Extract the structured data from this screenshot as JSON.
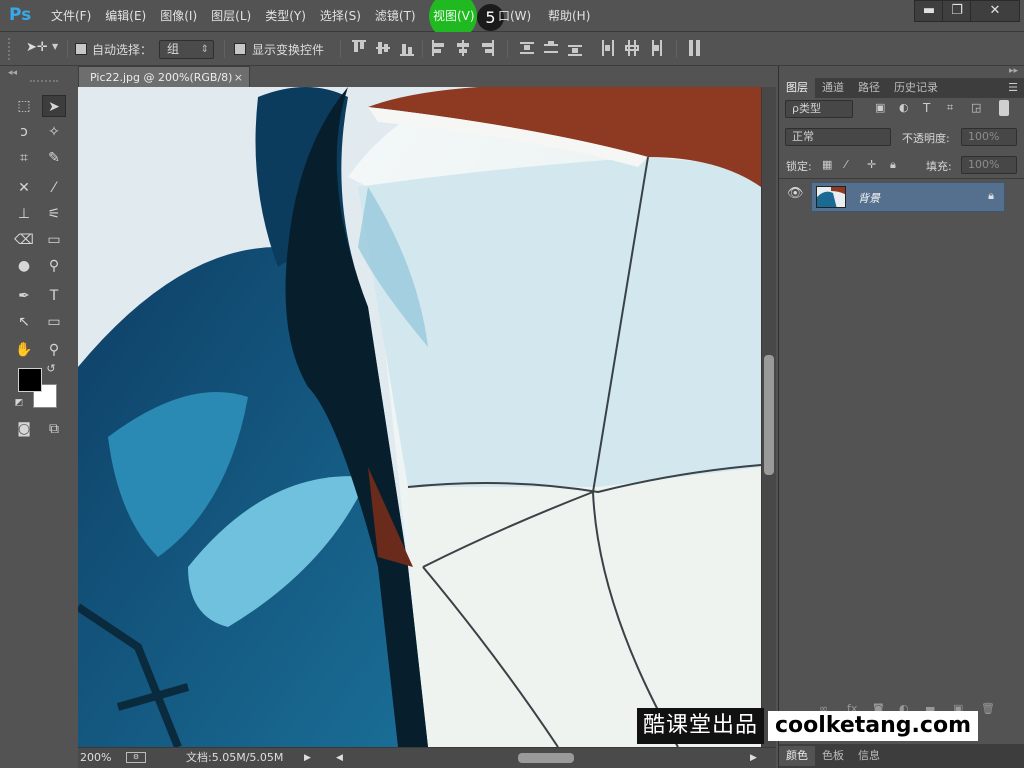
{
  "app": {
    "logo": "Ps"
  },
  "menu": {
    "items": [
      "文件(F)",
      "编辑(E)",
      "图像(I)",
      "图层(L)",
      "类型(Y)",
      "选择(S)",
      "滤镜(T)"
    ],
    "view_label": "视图(V)",
    "window_label": "口(W)",
    "help_label": "帮助(H)",
    "step_badge": "5"
  },
  "window_controls": {
    "minimize": "▬",
    "restore": "❐",
    "close": "✕"
  },
  "options_bar": {
    "auto_select_label": "自动选择：",
    "auto_select_value": "组",
    "show_transform_label": "显示变换控件"
  },
  "document": {
    "tab_title": "Pic22.jpg @ 200%(RGB/8)",
    "close_glyph": "×"
  },
  "status": {
    "zoom": "200%",
    "doc_info": "文档:5.05M/5.05M"
  },
  "panels": {
    "tabs": [
      "图层",
      "通道",
      "路径",
      "历史记录"
    ],
    "filter_label": "ρ类型",
    "blend_mode": "正常",
    "opacity_label": "不透明度:",
    "opacity_value": "100%",
    "lock_label": "锁定:",
    "fill_label": "填充:",
    "fill_value": "100%",
    "layers": [
      {
        "name": "背景",
        "visible": true,
        "locked": true
      }
    ],
    "bottom_tabs": [
      "颜色",
      "色板",
      "信息"
    ]
  },
  "watermark": {
    "cn": "酷课堂出品",
    "en": "coolketang.com"
  },
  "colors": {
    "accent_highlight": "#1fbf1f",
    "layer_selected": "#55708f",
    "ps_logo": "#38a8e8"
  }
}
